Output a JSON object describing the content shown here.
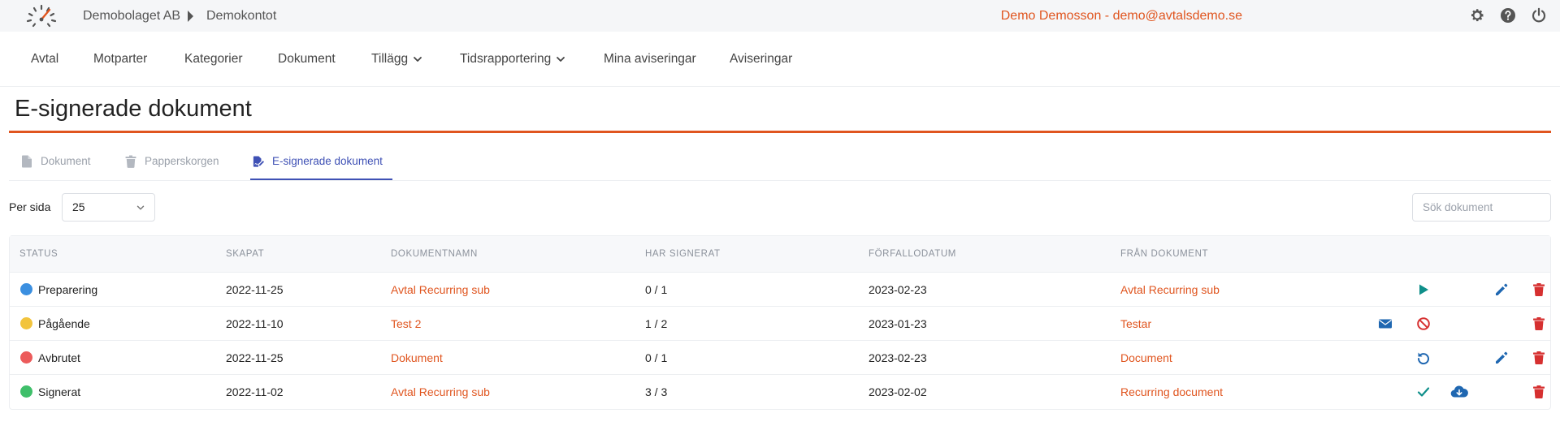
{
  "header": {
    "company": "Demobolaget AB",
    "account": "Demokontot",
    "user": "Demo Demosson - demo@avtalsdemo.se"
  },
  "nav": {
    "items": [
      "Avtal",
      "Motparter",
      "Kategorier",
      "Dokument",
      "Tillägg",
      "Tidsrapportering",
      "Mina aviseringar",
      "Aviseringar"
    ]
  },
  "page": {
    "title": "E-signerade dokument"
  },
  "tabs": [
    "Dokument",
    "Papperskorgen",
    "E-signerade dokument"
  ],
  "controls": {
    "per_page_label": "Per sida",
    "per_page_value": "25",
    "search_placeholder": "Sök dokument"
  },
  "table": {
    "headers": [
      "STATUS",
      "SKAPAT",
      "DOKUMENTNAMN",
      "HAR SIGNERAT",
      "FÖRFALLODATUM",
      "FRÅN DOKUMENT"
    ],
    "rows": [
      {
        "status": "Preparering",
        "color": "#3b8fe0",
        "created": "2022-11-25",
        "name": "Avtal Recurring sub",
        "signed": "0 / 1",
        "due": "2023-02-23",
        "source": "Avtal Recurring sub"
      },
      {
        "status": "Pågående",
        "color": "#f2c43d",
        "created": "2022-11-10",
        "name": "Test 2",
        "signed": "1 / 2",
        "due": "2023-01-23",
        "source": "Testar"
      },
      {
        "status": "Avbrutet",
        "color": "#ec5b5b",
        "created": "2022-11-25",
        "name": "Dokument",
        "signed": "0 / 1",
        "due": "2023-02-23",
        "source": "Document"
      },
      {
        "status": "Signerat",
        "color": "#3fbf6a",
        "created": "2022-11-02",
        "name": "Avtal Recurring sub",
        "signed": "3 / 3",
        "due": "2023-02-02",
        "source": "Recurring document"
      }
    ]
  },
  "colors": {
    "accent": "#e0551f",
    "active_tab": "#3f51b5",
    "action_blue": "#1f67b1",
    "delete_red": "#d63030",
    "play_teal": "#0f8f8a"
  }
}
